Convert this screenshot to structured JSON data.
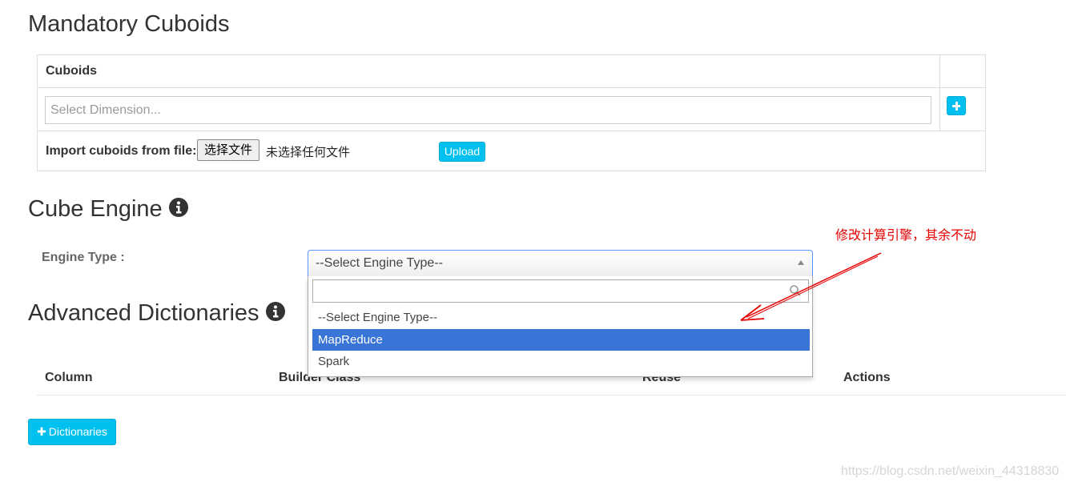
{
  "mandatory_cuboids": {
    "title": "Mandatory Cuboids",
    "column_header": "Cuboids",
    "select_placeholder": "Select Dimension...",
    "import_label": "Import cuboids from file:",
    "choose_file_label": "选择文件",
    "no_file_text": "未选择任何文件",
    "upload_label": "Upload"
  },
  "cube_engine": {
    "title": "Cube Engine",
    "engine_type_label": "Engine Type :",
    "selected_value": "--Select Engine Type--",
    "options": [
      "--Select Engine Type--",
      "MapReduce",
      "Spark"
    ],
    "highlighted_option": "MapReduce"
  },
  "advanced_dictionaries": {
    "title": "Advanced Dictionaries",
    "columns": [
      "Column",
      "Builder Class",
      "Reuse",
      "Actions"
    ],
    "add_button_label": "Dictionaries"
  },
  "annotation": {
    "text": "修改计算引擎，其余不动",
    "color": "#e60000"
  },
  "watermark": "https://blog.csdn.net/weixin_44318830",
  "colors": {
    "accent": "#00c0ef",
    "highlight": "#3875d7",
    "focus_border": "#5897fb"
  },
  "icons": [
    "info-icon",
    "plus-icon",
    "search-icon",
    "caret-up-icon"
  ]
}
